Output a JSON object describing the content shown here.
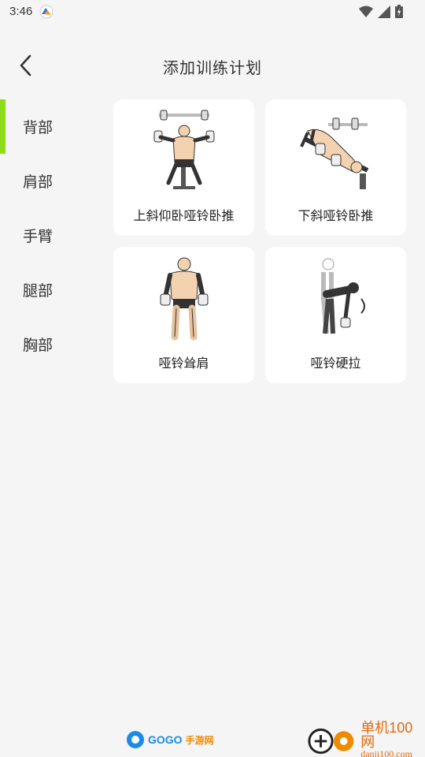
{
  "status_bar": {
    "time": "3:46"
  },
  "header": {
    "title": "添加训练计划"
  },
  "sidebar": {
    "items": [
      {
        "label": "背部",
        "active": true
      },
      {
        "label": "肩部",
        "active": false
      },
      {
        "label": "手臂",
        "active": false
      },
      {
        "label": "腿部",
        "active": false
      },
      {
        "label": "胸部",
        "active": false
      }
    ]
  },
  "exercises": [
    {
      "label": "上斜仰卧哑铃卧推",
      "icon": "incline-dumbbell-press-icon"
    },
    {
      "label": "下斜哑铃卧推",
      "icon": "decline-dumbbell-press-icon"
    },
    {
      "label": "哑铃耸肩",
      "icon": "dumbbell-shrug-icon"
    },
    {
      "label": "哑铃硬拉",
      "icon": "dumbbell-deadlift-icon"
    }
  ],
  "watermark": {
    "left_brand": "GOGO",
    "left_brand_sub": "手游网",
    "right_brand": "单机100网",
    "right_url": "danji100.com"
  },
  "colors": {
    "accent": "#8fdc1a",
    "background": "#f5f5f5",
    "card": "#ffffff"
  }
}
